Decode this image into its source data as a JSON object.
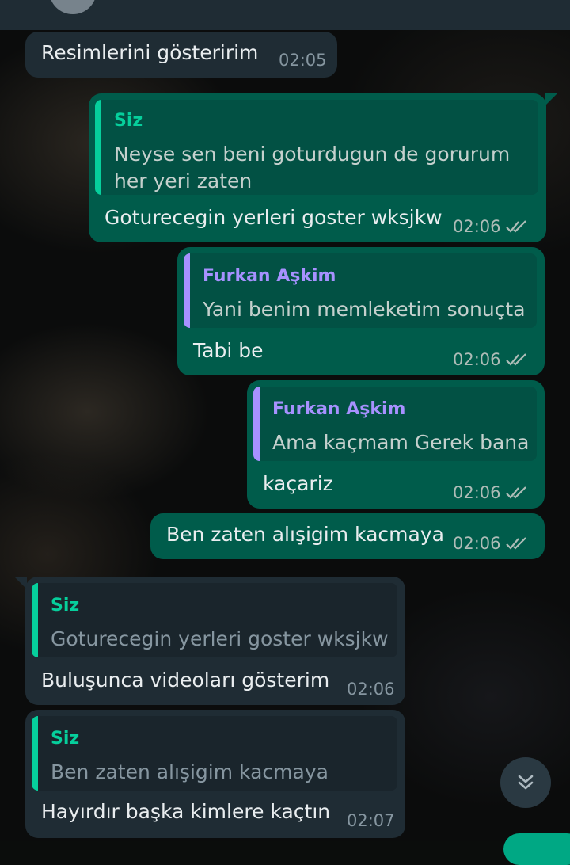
{
  "messages": [
    {
      "direction": "in",
      "text": "Resimlerini gösteririm",
      "time": "02:05"
    },
    {
      "direction": "out",
      "quote": {
        "author": "Siz",
        "line1": "Neyse sen beni goturdugun de gorurum",
        "line2": "her yeri zaten"
      },
      "text": "Goturecegin yerleri goster wksjkw",
      "time": "02:06",
      "status": "read"
    },
    {
      "direction": "out",
      "quote": {
        "author": "Furkan Aşkim",
        "line1": "Yani benim memleketim sonuçta"
      },
      "text": "Tabi be",
      "time": "02:06",
      "status": "read"
    },
    {
      "direction": "out",
      "quote": {
        "author": "Furkan Aşkim",
        "line1": "Ama kaçmam Gerek bana"
      },
      "text": "kaçariz",
      "time": "02:06",
      "status": "read"
    },
    {
      "direction": "out",
      "text": "Ben zaten alışigim kacmaya",
      "time": "02:06",
      "status": "read"
    },
    {
      "direction": "in",
      "quote": {
        "author": "Siz",
        "line1": "Goturecegin yerleri goster wksjkw"
      },
      "text": "Buluşunca videoları gösterim",
      "time": "02:06"
    },
    {
      "direction": "in",
      "quote": {
        "author": "Siz",
        "line1": "Ben zaten alışigim kacmaya"
      },
      "text": "Hayırdır başka kimlere kaçtın",
      "time": "02:07"
    }
  ],
  "icons": {
    "scroll_down": "double-chevron-down-icon",
    "read_receipt": "double-check-icon"
  },
  "colors": {
    "incoming_bubble": "#1f2c34",
    "outgoing_bubble": "#005c4b",
    "quote_self": "#06cf9c",
    "quote_contact": "#a791ff",
    "read_tick": "#aebcb7"
  }
}
